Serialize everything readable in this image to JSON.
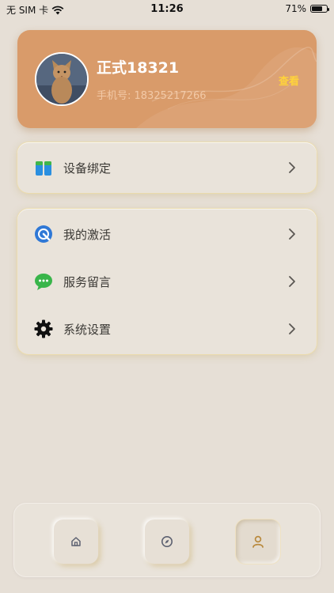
{
  "status_bar": {
    "carrier": "无 SIM 卡",
    "time": "11:26",
    "battery_percent": "71%",
    "battery_level": 0.71
  },
  "profile": {
    "name": "正式18321",
    "phone": "手机号: 18325217266",
    "view_label": "查看"
  },
  "menu_group_1": [
    {
      "label": "设备绑定",
      "icon": "device-bind-icon"
    }
  ],
  "menu_group_2": [
    {
      "label": "我的激活",
      "icon": "activation-icon"
    },
    {
      "label": "服务留言",
      "icon": "message-icon"
    },
    {
      "label": "系统设置",
      "icon": "settings-icon"
    }
  ],
  "tabbar": [
    {
      "icon": "home-icon",
      "active": false
    },
    {
      "icon": "compass-icon",
      "active": false
    },
    {
      "icon": "user-icon",
      "active": true
    }
  ],
  "colors": {
    "background": "#e6dfd6",
    "profile_card": "#d99b6a",
    "accent": "#ffd33a",
    "active_tab_icon": "#b98a3e"
  }
}
